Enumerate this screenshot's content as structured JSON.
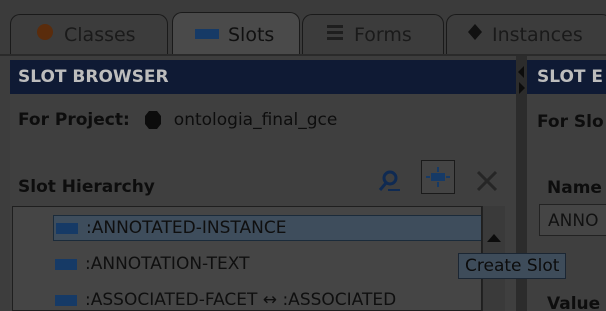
{
  "tabs": [
    {
      "label": "Classes",
      "icon": "class-icon",
      "active": false
    },
    {
      "label": "Slots",
      "icon": "slot-icon",
      "active": true
    },
    {
      "label": "Forms",
      "icon": "form-icon",
      "active": false
    },
    {
      "label": "Instances",
      "icon": "instance-icon",
      "active": false
    }
  ],
  "browser": {
    "title": "SLOT BROWSER",
    "project_label": "For Project:",
    "project_name": "ontologia_final_gce",
    "hierarchy_label": "Slot Hierarchy"
  },
  "slots": [
    {
      "label": ":ANNOTATED-INSTANCE",
      "selected": true
    },
    {
      "label": ":ANNOTATION-TEXT",
      "selected": false
    },
    {
      "label": ":ASSOCIATED-FACET ↔ :ASSOCIATED",
      "selected": false
    }
  ],
  "tooltip": "Create Slot",
  "editor": {
    "title": "SLOT E",
    "for_label": "For Slo",
    "name_label": "Name",
    "name_value": "ANNO",
    "value_label": "Value"
  },
  "colors": {
    "header_bg": "#0f1a34",
    "slot_icon": "#163a66",
    "class_icon": "#5a2c0c"
  }
}
